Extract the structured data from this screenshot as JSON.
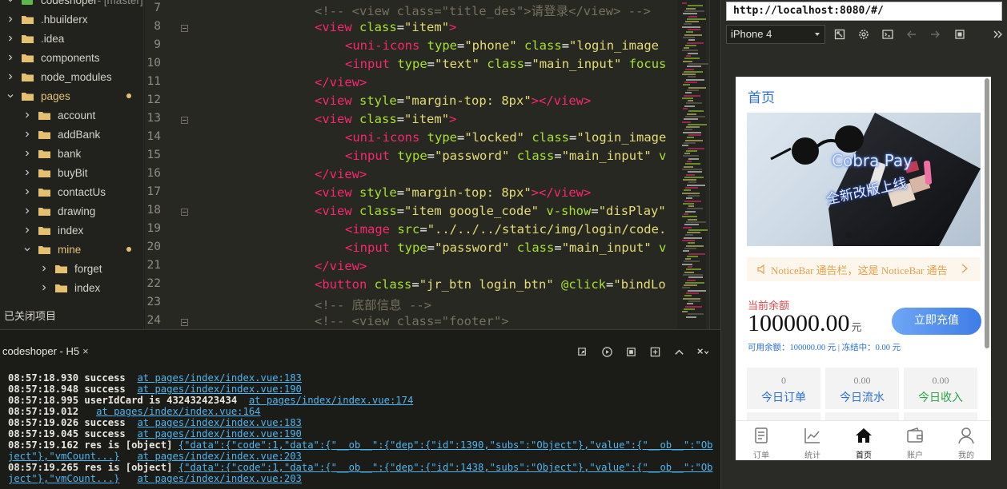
{
  "sidebar": {
    "items": [
      {
        "label": "codeshoper",
        "suffix": " - [master]",
        "indent": 0,
        "open": true,
        "dot": false
      },
      {
        "label": ".hbuilderx",
        "indent": 0,
        "open": false,
        "dot": false
      },
      {
        "label": ".idea",
        "indent": 0,
        "open": false,
        "dot": false
      },
      {
        "label": "components",
        "indent": 0,
        "open": false,
        "dot": false
      },
      {
        "label": "node_modules",
        "indent": 0,
        "open": false,
        "dot": false
      },
      {
        "label": "pages",
        "indent": 0,
        "open": true,
        "dot": true
      },
      {
        "label": "account",
        "indent": 1,
        "open": false,
        "dot": false
      },
      {
        "label": "addBank",
        "indent": 1,
        "open": false,
        "dot": false
      },
      {
        "label": "bank",
        "indent": 1,
        "open": false,
        "dot": false
      },
      {
        "label": "buyBit",
        "indent": 1,
        "open": false,
        "dot": false
      },
      {
        "label": "contactUs",
        "indent": 1,
        "open": false,
        "dot": false
      },
      {
        "label": "drawing",
        "indent": 1,
        "open": false,
        "dot": false
      },
      {
        "label": "index",
        "indent": 1,
        "open": false,
        "dot": false
      },
      {
        "label": "mine",
        "indent": 1,
        "open": true,
        "dot": true
      },
      {
        "label": "forget",
        "indent": 2,
        "open": false,
        "dot": false
      },
      {
        "label": "index",
        "indent": 2,
        "open": false,
        "dot": false
      }
    ],
    "closed_projects": "已关闭项目"
  },
  "editor": {
    "lines": [
      {
        "n": "7",
        "fold": false,
        "indent": 0,
        "tokens": [
          [
            "com",
            "<!-- <view class=\"title_des\">请登录</view> -->"
          ]
        ]
      },
      {
        "n": "8",
        "fold": true,
        "indent": 0,
        "tokens": [
          [
            "tag",
            "<view"
          ],
          [
            "pun",
            " "
          ],
          [
            "attr",
            "class"
          ],
          [
            "pun",
            "="
          ],
          [
            "str",
            "\"item\""
          ],
          [
            "tag",
            ">"
          ]
        ]
      },
      {
        "n": "9",
        "fold": false,
        "indent": 1,
        "tokens": [
          [
            "tag",
            "<uni-icons"
          ],
          [
            "pun",
            " "
          ],
          [
            "attr",
            "type"
          ],
          [
            "pun",
            "="
          ],
          [
            "str",
            "\"phone\""
          ],
          [
            "pun",
            " "
          ],
          [
            "attr",
            "class"
          ],
          [
            "pun",
            "="
          ],
          [
            "str",
            "\"login_image"
          ]
        ]
      },
      {
        "n": "10",
        "fold": false,
        "indent": 1,
        "tokens": [
          [
            "tag",
            "<input"
          ],
          [
            "pun",
            " "
          ],
          [
            "attr",
            "type"
          ],
          [
            "pun",
            "="
          ],
          [
            "str",
            "\"text\""
          ],
          [
            "pun",
            " "
          ],
          [
            "attr",
            "class"
          ],
          [
            "pun",
            "="
          ],
          [
            "str",
            "\"main_input\""
          ],
          [
            "pun",
            " "
          ],
          [
            "attr",
            "focus"
          ]
        ]
      },
      {
        "n": "11",
        "fold": false,
        "indent": 0,
        "tokens": [
          [
            "tag",
            "</view>"
          ]
        ]
      },
      {
        "n": "12",
        "fold": false,
        "indent": 0,
        "tokens": [
          [
            "tag",
            "<view"
          ],
          [
            "pun",
            " "
          ],
          [
            "attr",
            "style"
          ],
          [
            "pun",
            "="
          ],
          [
            "str",
            "\"margin-top: 8px\""
          ],
          [
            "tag",
            "></view>"
          ]
        ]
      },
      {
        "n": "13",
        "fold": true,
        "indent": 0,
        "tokens": [
          [
            "tag",
            "<view"
          ],
          [
            "pun",
            " "
          ],
          [
            "attr",
            "class"
          ],
          [
            "pun",
            "="
          ],
          [
            "str",
            "\"item\""
          ],
          [
            "tag",
            ">"
          ]
        ]
      },
      {
        "n": "14",
        "fold": false,
        "indent": 1,
        "tokens": [
          [
            "tag",
            "<uni-icons"
          ],
          [
            "pun",
            " "
          ],
          [
            "attr",
            "type"
          ],
          [
            "pun",
            "="
          ],
          [
            "str",
            "\"locked\""
          ],
          [
            "pun",
            " "
          ],
          [
            "attr",
            "class"
          ],
          [
            "pun",
            "="
          ],
          [
            "str",
            "\"login_image"
          ]
        ]
      },
      {
        "n": "15",
        "fold": false,
        "indent": 1,
        "tokens": [
          [
            "tag",
            "<input"
          ],
          [
            "pun",
            " "
          ],
          [
            "attr",
            "type"
          ],
          [
            "pun",
            "="
          ],
          [
            "str",
            "\"password\""
          ],
          [
            "pun",
            " "
          ],
          [
            "attr",
            "class"
          ],
          [
            "pun",
            "="
          ],
          [
            "str",
            "\"main_input\""
          ],
          [
            "pun",
            " "
          ],
          [
            "attr",
            "v"
          ]
        ]
      },
      {
        "n": "16",
        "fold": false,
        "indent": 0,
        "tokens": [
          [
            "tag",
            "</view>"
          ]
        ]
      },
      {
        "n": "17",
        "fold": false,
        "indent": 0,
        "tokens": [
          [
            "tag",
            "<view"
          ],
          [
            "pun",
            " "
          ],
          [
            "attr",
            "style"
          ],
          [
            "pun",
            "="
          ],
          [
            "str",
            "\"margin-top: 8px\""
          ],
          [
            "tag",
            "></view>"
          ]
        ]
      },
      {
        "n": "18",
        "fold": true,
        "indent": 0,
        "tokens": [
          [
            "tag",
            "<view"
          ],
          [
            "pun",
            " "
          ],
          [
            "attr",
            "class"
          ],
          [
            "pun",
            "="
          ],
          [
            "str",
            "\"item google_code\""
          ],
          [
            "pun",
            " "
          ],
          [
            "attr",
            "v-show"
          ],
          [
            "pun",
            "="
          ],
          [
            "str",
            "\"disPlay\""
          ]
        ]
      },
      {
        "n": "19",
        "fold": false,
        "indent": 1,
        "tokens": [
          [
            "tag",
            "<image"
          ],
          [
            "pun",
            " "
          ],
          [
            "attr",
            "src"
          ],
          [
            "pun",
            "="
          ],
          [
            "str",
            "\"../../../static/img/login/code."
          ]
        ]
      },
      {
        "n": "20",
        "fold": false,
        "indent": 1,
        "tokens": [
          [
            "tag",
            "<input"
          ],
          [
            "pun",
            " "
          ],
          [
            "attr",
            "type"
          ],
          [
            "pun",
            "="
          ],
          [
            "str",
            "\"password\""
          ],
          [
            "pun",
            " "
          ],
          [
            "attr",
            "class"
          ],
          [
            "pun",
            "="
          ],
          [
            "str",
            "\"main_input\""
          ],
          [
            "pun",
            " "
          ],
          [
            "attr",
            "v"
          ]
        ]
      },
      {
        "n": "21",
        "fold": false,
        "indent": 0,
        "tokens": [
          [
            "tag",
            "</view>"
          ]
        ]
      },
      {
        "n": "22",
        "fold": false,
        "indent": 0,
        "tokens": [
          [
            "tag",
            "<button"
          ],
          [
            "pun",
            " "
          ],
          [
            "attr",
            "class"
          ],
          [
            "pun",
            "="
          ],
          [
            "str",
            "\"jr_btn login_btn\""
          ],
          [
            "pun",
            " "
          ],
          [
            "attr",
            "@click"
          ],
          [
            "pun",
            "="
          ],
          [
            "str",
            "\"bindLo"
          ]
        ]
      },
      {
        "n": "23",
        "fold": false,
        "indent": 0,
        "tokens": [
          [
            "com",
            "<!-- 底部信息 -->"
          ]
        ]
      },
      {
        "n": "24",
        "fold": true,
        "indent": 0,
        "tokens": [
          [
            "com",
            "<!-- <view class=\"footer\">"
          ]
        ]
      }
    ]
  },
  "console": {
    "tab_label": "codeshoper - H5",
    "tab_close": "×",
    "logs": [
      {
        "text": "08:57:18.930 success  ",
        "link": "at pages/index/index.vue:183"
      },
      {
        "text": "08:57:18.948 success  ",
        "link": "at pages/index/index.vue:190"
      },
      {
        "text": "08:57:18.995 userIdCard is 432432423434  ",
        "link": "at pages/index/index.vue:174"
      },
      {
        "text": "08:57:19.012   ",
        "link": "at pages/index/index.vue:164"
      },
      {
        "text": "08:57:19.026 success  ",
        "link": "at pages/index/index.vue:183"
      },
      {
        "text": "08:57:19.045 success  ",
        "link": "at pages/index/index.vue:190"
      },
      {
        "text": "08:57:19.162 res is [object] ",
        "link": "{\"data\":{\"code\":1,\"data\":{\"__ob__\":{\"dep\":{\"id\":1390,\"subs\":\"Object\"},\"value\":{\"__ob__\":\"Ob"
      },
      {
        "text": "",
        "link": "ject\"},\"vmCount...}",
        "link2": "at pages/index/index.vue:203"
      },
      {
        "text": "08:57:19.265 res is [object] ",
        "link": "{\"data\":{\"code\":1,\"data\":{\"__ob__\":{\"dep\":{\"id\":1438,\"subs\":\"Object\"},\"value\":{\"__ob__\":\"Ob"
      },
      {
        "text": "",
        "link": "ject\"},\"vmCount...}",
        "link2": "at pages/index/index.vue:203"
      }
    ]
  },
  "browser": {
    "url": "http://localhost:8080/#/",
    "device": "iPhone 4"
  },
  "app": {
    "title": "首页",
    "banner_title": "Cobra Pay",
    "banner_sub": "全新改版上线",
    "notice": "NoticeBar 通告栏，这是 NoticeBar 通告",
    "balance_label": "当前余额",
    "balance_amount": "100000.00",
    "balance_unit": "元",
    "recharge": "立即充值",
    "sub_balance": "可用余额：100000.00 元  |  冻结中：0.00 元",
    "stats": [
      {
        "value": "0",
        "label": "今日订单",
        "color": "#2a6fd8"
      },
      {
        "value": "0.00",
        "label": "今日流水",
        "color": "#2a6fd8"
      },
      {
        "value": "0.00",
        "label": "今日收入",
        "color": "#27a845"
      }
    ],
    "tabs": [
      {
        "label": "订单",
        "icon": "order-icon",
        "active": false
      },
      {
        "label": "统计",
        "icon": "chart-icon",
        "active": false
      },
      {
        "label": "首页",
        "icon": "home-icon",
        "active": true
      },
      {
        "label": "账户",
        "icon": "wallet-icon",
        "active": false
      },
      {
        "label": "我的",
        "icon": "user-icon",
        "active": false
      }
    ]
  },
  "colors": {
    "editor_bg": "#272822",
    "tag": "#f92672",
    "attr": "#a6e22e",
    "string": "#e6db74",
    "comment": "#75715e",
    "accent": "#2a6fd8",
    "folder": "#e4c070"
  }
}
